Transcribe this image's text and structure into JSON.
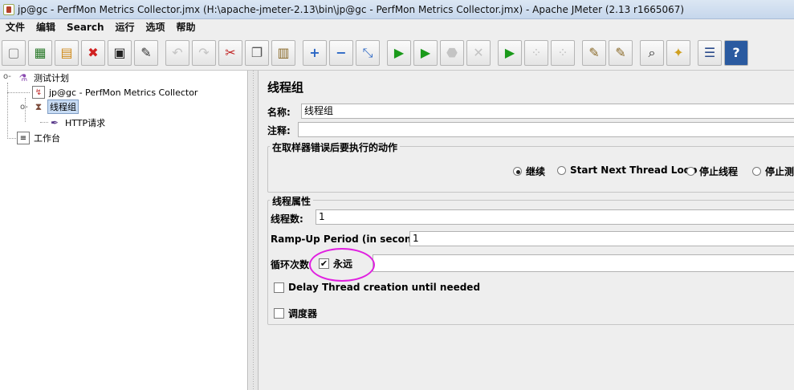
{
  "window": {
    "title": "jp@gc - PerfMon Metrics Collector.jmx (H:\\apache-jmeter-2.13\\bin\\jp@gc - PerfMon Metrics Collector.jmx) - Apache JMeter (2.13 r1665067)"
  },
  "menu": [
    "文件",
    "编辑",
    "Search",
    "运行",
    "选项",
    "帮助"
  ],
  "toolbar": [
    {
      "icon": "new-icon",
      "glyph": "▢"
    },
    {
      "icon": "templates-icon",
      "glyph": "▦"
    },
    {
      "icon": "open-icon",
      "glyph": "▤"
    },
    {
      "icon": "close-file-icon",
      "glyph": "✖"
    },
    {
      "icon": "save-icon",
      "glyph": "▣"
    },
    {
      "icon": "save-as-icon",
      "glyph": "✎"
    },
    {
      "icon": "undo-icon",
      "glyph": "↶"
    },
    {
      "icon": "redo-icon",
      "glyph": "↷"
    },
    {
      "icon": "cut-icon",
      "glyph": "✂"
    },
    {
      "icon": "copy-icon",
      "glyph": "❐"
    },
    {
      "icon": "paste-icon",
      "glyph": "▥"
    },
    {
      "icon": "expand-icon",
      "glyph": "+"
    },
    {
      "icon": "collapse-icon",
      "glyph": "−"
    },
    {
      "icon": "toggle-icon",
      "glyph": "⤡"
    },
    {
      "icon": "start-icon",
      "glyph": "▶"
    },
    {
      "icon": "start-no-pause-icon",
      "glyph": "▶"
    },
    {
      "icon": "stop-icon",
      "glyph": "⬣"
    },
    {
      "icon": "shutdown-icon",
      "glyph": "✕"
    },
    {
      "icon": "remote-start-icon",
      "glyph": "▶"
    },
    {
      "icon": "remote-stop-icon",
      "glyph": "⁘"
    },
    {
      "icon": "remote-shutdown-icon",
      "glyph": "⁘"
    },
    {
      "icon": "clear-icon",
      "glyph": "✎"
    },
    {
      "icon": "clear-all-icon",
      "glyph": "✎"
    },
    {
      "icon": "search-icon",
      "glyph": "⌕"
    },
    {
      "icon": "reset-search-icon",
      "glyph": "✦"
    },
    {
      "icon": "function-helper-icon",
      "glyph": "☰"
    },
    {
      "icon": "help-icon",
      "glyph": "?"
    }
  ],
  "tree": {
    "test_plan": "测试计划",
    "perfmon": "jp@gc - PerfMon Metrics Collector",
    "thread_group": "线程组",
    "http_request": "HTTP请求",
    "workbench": "工作台"
  },
  "panel": {
    "title": "线程组",
    "name_label": "名称:",
    "name_value": "线程组",
    "comment_label": "注释:",
    "comment_value": "",
    "error_action_legend": "在取样器错误后要执行的动作",
    "error_actions": [
      "继续",
      "Start Next Thread Loop",
      "停止线程",
      "停止测"
    ],
    "error_action_selected": 0,
    "thread_props_legend": "线程属性",
    "threads_label": "线程数:",
    "threads_value": "1",
    "rampup_label": "Ramp-Up Period (in seconds):",
    "rampup_value": "1",
    "loop_label": "循环次数",
    "forever_label": "永远",
    "forever_checked": true,
    "loop_value": "",
    "delay_label": "Delay Thread creation until needed",
    "delay_checked": false,
    "scheduler_label": "调度器",
    "scheduler_checked": false
  }
}
